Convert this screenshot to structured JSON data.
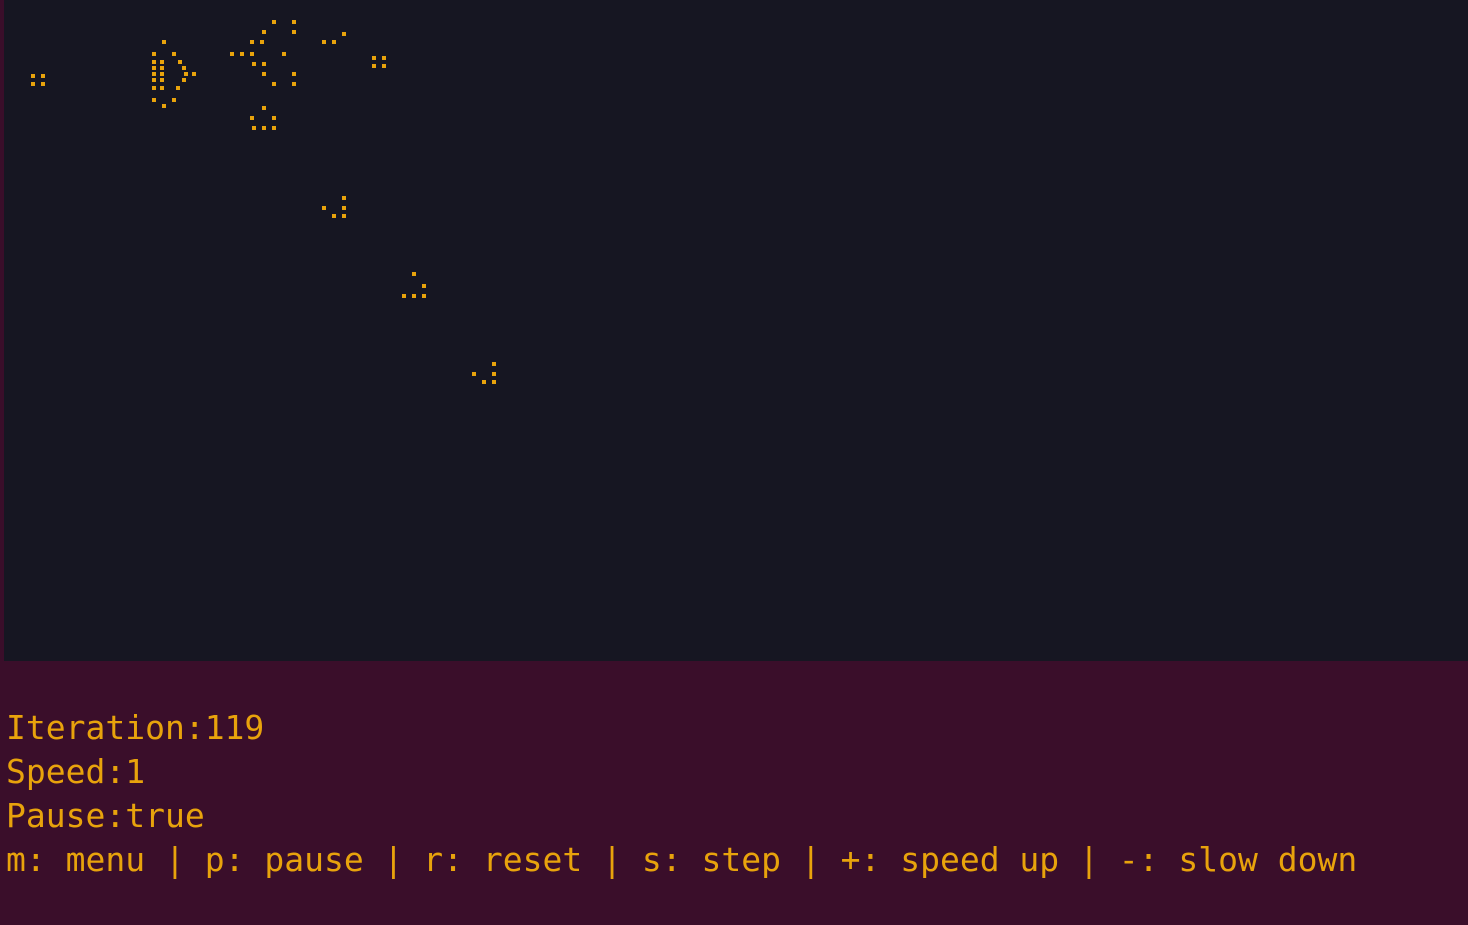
{
  "game": {
    "colors": {
      "background": "#161622",
      "panel": "#3a0e2a",
      "cell": "#e8a30c",
      "text": "#e8a30c",
      "accent": "#d23a2a"
    },
    "status": {
      "iteration_label": "Iteration:",
      "iteration": "119",
      "speed_label": "Speed:",
      "speed": "1",
      "pause_label": "Pause:",
      "pause": "true"
    },
    "help": {
      "items": [
        {
          "key": "m",
          "label": "menu"
        },
        {
          "key": "p",
          "label": "pause"
        },
        {
          "key": "r",
          "label": "reset"
        },
        {
          "key": "s",
          "label": "step"
        },
        {
          "key": "+",
          "label": "speed up"
        },
        {
          "key": "-",
          "label": "slow down"
        }
      ],
      "separator": " | "
    }
  }
}
